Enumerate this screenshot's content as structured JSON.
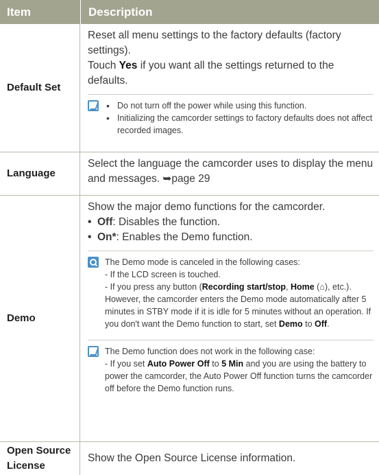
{
  "header": {
    "col_item": "Item",
    "col_desc": "Description"
  },
  "default_set": {
    "item": "Default Set",
    "line1": "Reset all menu settings to the factory defaults (factory settings).",
    "touch": "Touch ",
    "yes": "Yes",
    "line2": " if you want all the settings returned to the defaults.",
    "note_icon": "memo-icon",
    "notes": [
      "Do not turn off the power while using this function.",
      "Initializing the camcorder settings to factory defaults does not affect recorded images."
    ]
  },
  "language": {
    "item": "Language",
    "text": "Select the language the camcorder uses to display the menu and messages. ➥page 29"
  },
  "demo": {
    "item": "Demo",
    "intro": "Show the major demo functions for the camcorder.",
    "off_label": "Off",
    "off_text": ": Disables the function.",
    "on_label": "On*",
    "on_text": ": Enables the Demo function.",
    "search_icon": "search-icon",
    "info1": "The Demo mode is canceled in the following cases:",
    "info2": "- If the LCD screen is touched.",
    "info3a": "- If you press any button (",
    "info3b": "Recording start/stop",
    "info3c": ",",
    "info3d": "Home",
    "info3e": " (",
    "home_glyph": "⌂",
    "info3f": "), etc.). However, the camcorder enters the Demo mode automatically after 5 minutes in STBY mode if it is idle for 5 minutes without an operation. If you don't want the Demo function to start, set ",
    "info3g": "Demo",
    "info3h": " to ",
    "info3i": "Off",
    "info3j": ".",
    "memo_icon": "memo-icon",
    "memo1": "The Demo function does not work in the following case:",
    "memo2a": "- If you set ",
    "memo2b": "Auto Power Off",
    "memo2c": " to ",
    "memo2d": "5 Min",
    "memo2e": " and you are using the battery to power the camcorder, the Auto Power Off function turns the camcorder off before the Demo function runs."
  },
  "open_source": {
    "item": "Open Source License",
    "text": "Show the Open Source License information."
  }
}
